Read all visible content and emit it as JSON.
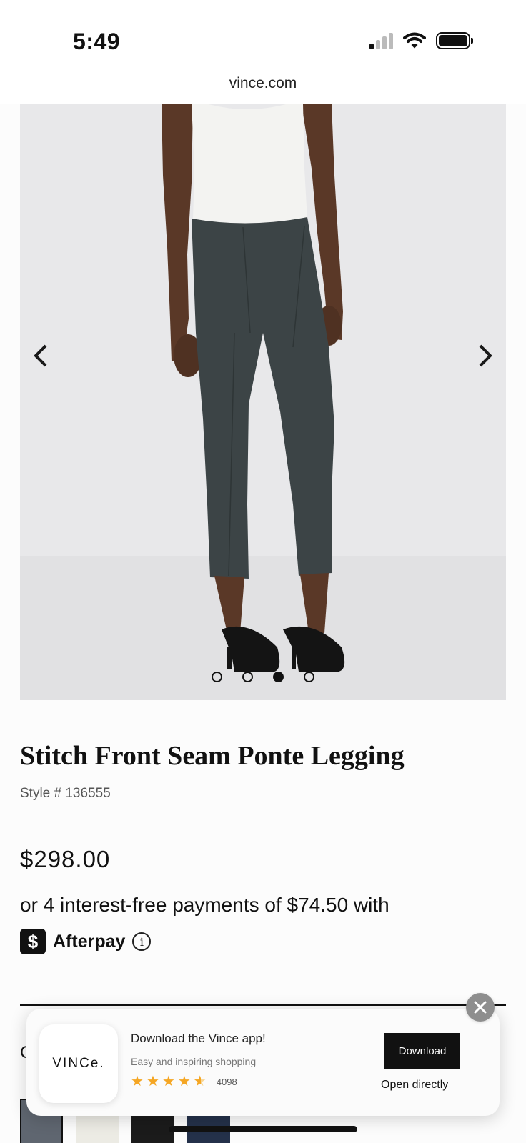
{
  "status_bar": {
    "time": "5:49"
  },
  "browser": {
    "url": "vince.com"
  },
  "gallery": {
    "image_count": 4,
    "active_index": 2
  },
  "product": {
    "title": "Stitch Front Seam Ponte Legging",
    "style_number": "Style # 136555",
    "price": "$298.00",
    "installments": "or 4 interest-free payments of $74.50 with",
    "afterpay_label": "Afterpay",
    "afterpay_logo_glyph": "$",
    "info_glyph": "i"
  },
  "partial_section_text": "C",
  "swatches": [
    {
      "color": "#5f6670"
    },
    {
      "color": "#ecebe4"
    },
    {
      "color": "#1b1b1b"
    },
    {
      "color": "#24314a"
    }
  ],
  "app_banner": {
    "app_name": "VINCe.",
    "title": "Download the Vince app!",
    "subtitle": "Easy and inspiring shopping",
    "rating": 4.5,
    "review_count": "4098",
    "download_label": "Download",
    "open_label": "Open directly"
  },
  "colors": {
    "accent": "#111111",
    "star": "#f5a623",
    "close_button": "#8e8e8e"
  }
}
